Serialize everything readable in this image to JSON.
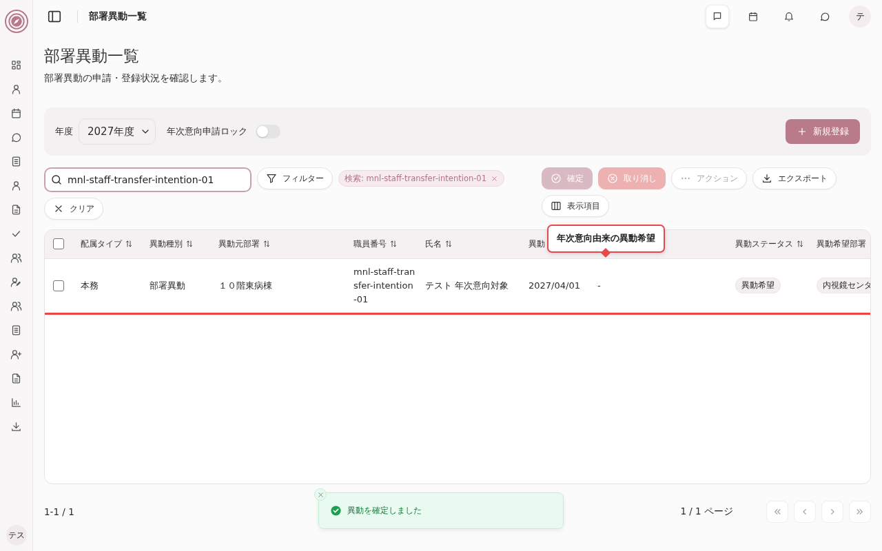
{
  "header": {
    "title": "部署異動一覧",
    "avatar": "テ"
  },
  "sidebar": {
    "avatar": "テス"
  },
  "page": {
    "title": "部署異動一覧",
    "subtitle": "部署異動の申請・登録状況を確認します。"
  },
  "filter_panel": {
    "year_label": "年度",
    "year_value": "2027年度",
    "lock_label": "年次意向申請ロック",
    "lock_on": false,
    "new_button": "新規登録"
  },
  "toolbar": {
    "search": {
      "value": "mnl-staff-transfer-intention-01"
    },
    "filter_button": "フィルター",
    "chips": [
      {
        "label": "検索: mnl-staff-transfer-intention-01"
      }
    ],
    "clear_button": "クリア",
    "actions": [
      {
        "kind": "confirm",
        "label": "確定",
        "disabled": true
      },
      {
        "kind": "cancel",
        "label": "取り消し",
        "disabled": true
      },
      {
        "kind": "more",
        "label": "アクション",
        "disabled": true
      },
      {
        "kind": "export",
        "label": "エクスポート",
        "disabled": false
      }
    ],
    "columns_button": "表示項目"
  },
  "tooltip": {
    "text": "年次意向由来の異動希望"
  },
  "table": {
    "all_checked": false,
    "columns": [
      {
        "label": "配属タイプ"
      },
      {
        "label": "異動種別"
      },
      {
        "label": "異動元部署"
      },
      {
        "label": "職員番号"
      },
      {
        "label": "氏名"
      },
      {
        "label": "異動"
      },
      {},
      {
        "label": "異動ステータス"
      },
      {
        "label": "異動希望部署"
      }
    ],
    "rows": [
      {
        "checked": false,
        "highlighted": true,
        "cells": [
          {
            "text": "本務"
          },
          {
            "text": "部署異動"
          },
          {
            "text": "１０階東病棟"
          },
          {
            "text": "mnl-staff-transfer-intention-01"
          },
          {
            "text": "テスト 年次意向対象"
          },
          {
            "text": "2027/04/01"
          },
          {
            "text": "-"
          },
          {
            "text": "異動希望",
            "kind": "tag"
          },
          {
            "text": "内視鏡センタ",
            "kind": "tag"
          }
        ]
      }
    ]
  },
  "footer": {
    "range": "1-1 / 1",
    "page": "1 / 1 ページ"
  },
  "toast": {
    "message": "異動を確定しました"
  }
}
